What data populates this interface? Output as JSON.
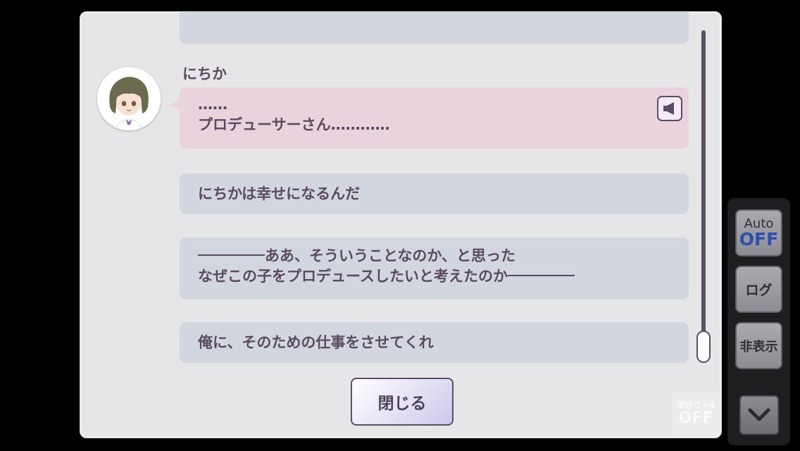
{
  "log": {
    "top_cut_text": "",
    "speaker": "にちか",
    "entry1": {
      "line1": "……",
      "line2": "プロデューサーさん…………"
    },
    "entry2": "にちかは幸せになるんだ",
    "entry3": {
      "line1": "ああ、そういうことなのか、と思った",
      "line2": "なぜこの子をプロデュースしたいと考えたのか"
    },
    "entry4": "俺に、そのための仕事をさせてくれ"
  },
  "close_label": "閉じる",
  "side": {
    "auto_label": "Auto",
    "auto_state": "OFF",
    "log_label": "ログ",
    "hide_label": "非表示",
    "ff_label": "早送り×4",
    "ff_state": "OFF"
  },
  "icons": {
    "voice": "speaker-icon",
    "down": "chevron-down-icon",
    "avatar": "character-avatar"
  },
  "colors": {
    "bubble": "#d1d6df",
    "bubble_highlight": "#ebd3dd",
    "text": "#5b4b60",
    "auto_off": "#2f4fb0"
  }
}
